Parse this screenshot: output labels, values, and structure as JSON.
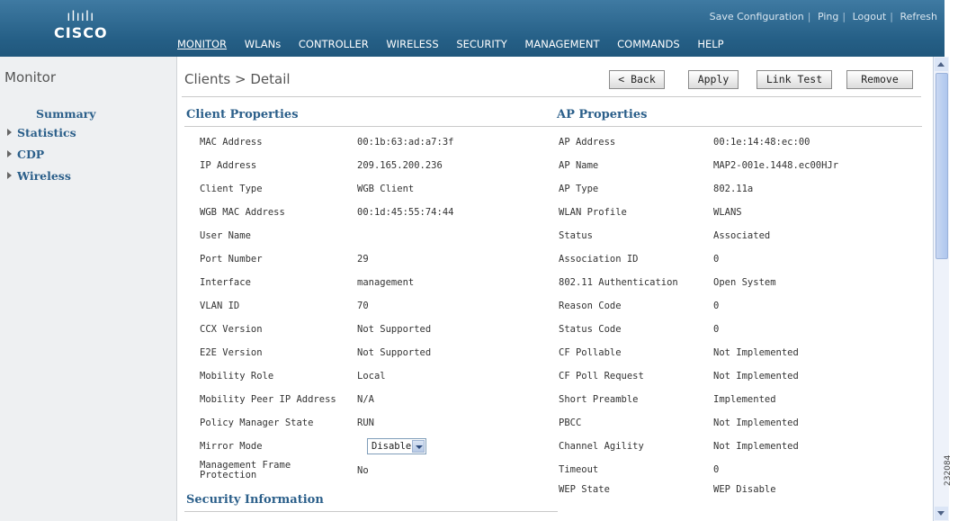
{
  "brand": {
    "logo_bars": "ılıılı",
    "logo_text": "CISCO"
  },
  "top_links": [
    "Save Configuration",
    "Ping",
    "Logout",
    "Refresh"
  ],
  "nav": [
    "MONITOR",
    "WLANs",
    "CONTROLLER",
    "WIRELESS",
    "SECURITY",
    "MANAGEMENT",
    "COMMANDS",
    "HELP"
  ],
  "sidebar": {
    "title": "Monitor",
    "items": [
      {
        "label": "Summary",
        "expandable": false
      },
      {
        "label": "Statistics",
        "expandable": true
      },
      {
        "label": "CDP",
        "expandable": true
      },
      {
        "label": "Wireless",
        "expandable": true
      }
    ]
  },
  "page": {
    "title": "Clients > Detail",
    "buttons": {
      "back": "< Back",
      "apply": "Apply",
      "link_test": "Link Test",
      "remove": "Remove"
    }
  },
  "client_properties": {
    "heading": "Client Properties",
    "rows": [
      {
        "label": "MAC Address",
        "value": "00:1b:63:ad:a7:3f"
      },
      {
        "label": "IP Address",
        "value": "209.165.200.236"
      },
      {
        "label": "Client Type",
        "value": "WGB Client"
      },
      {
        "label": "WGB MAC Address",
        "value": "00:1d:45:55:74:44"
      },
      {
        "label": "User Name",
        "value": ""
      },
      {
        "label": "Port Number",
        "value": "29"
      },
      {
        "label": "Interface",
        "value": "management"
      },
      {
        "label": "VLAN ID",
        "value": "70"
      },
      {
        "label": "CCX Version",
        "value": "Not Supported"
      },
      {
        "label": "E2E Version",
        "value": "Not Supported"
      },
      {
        "label": "Mobility Role",
        "value": "Local"
      },
      {
        "label": "Mobility Peer IP Address",
        "value": "N/A"
      },
      {
        "label": "Policy Manager State",
        "value": "RUN"
      },
      {
        "label": "Mirror Mode",
        "value": "Disable"
      },
      {
        "label": "Management Frame Protection",
        "value": "No"
      }
    ]
  },
  "ap_properties": {
    "heading": "AP Properties",
    "rows": [
      {
        "label": "AP Address",
        "value": "00:1e:14:48:ec:00"
      },
      {
        "label": "AP Name",
        "value": "MAP2-001e.1448.ec00HJr"
      },
      {
        "label": "AP Type",
        "value": "802.11a"
      },
      {
        "label": "WLAN Profile",
        "value": "WLANS"
      },
      {
        "label": "Status",
        "value": "Associated"
      },
      {
        "label": "Association ID",
        "value": "0"
      },
      {
        "label": "802.11 Authentication",
        "value": "Open System"
      },
      {
        "label": "Reason Code",
        "value": "0"
      },
      {
        "label": "Status Code",
        "value": "0"
      },
      {
        "label": "CF Pollable",
        "value": "Not Implemented"
      },
      {
        "label": "CF Poll Request",
        "value": "Not Implemented"
      },
      {
        "label": "Short Preamble",
        "value": "Implemented"
      },
      {
        "label": "PBCC",
        "value": "Not Implemented"
      },
      {
        "label": "Channel Agility",
        "value": "Not Implemented"
      },
      {
        "label": "Timeout",
        "value": "0"
      },
      {
        "label": "WEP State",
        "value": "WEP Disable"
      }
    ]
  },
  "security_heading": "Security Information",
  "figure_id": "232084",
  "colors": {
    "header": "#255f86",
    "section": "#2b5f8a",
    "sidebar_bg": "#eef0f2"
  }
}
